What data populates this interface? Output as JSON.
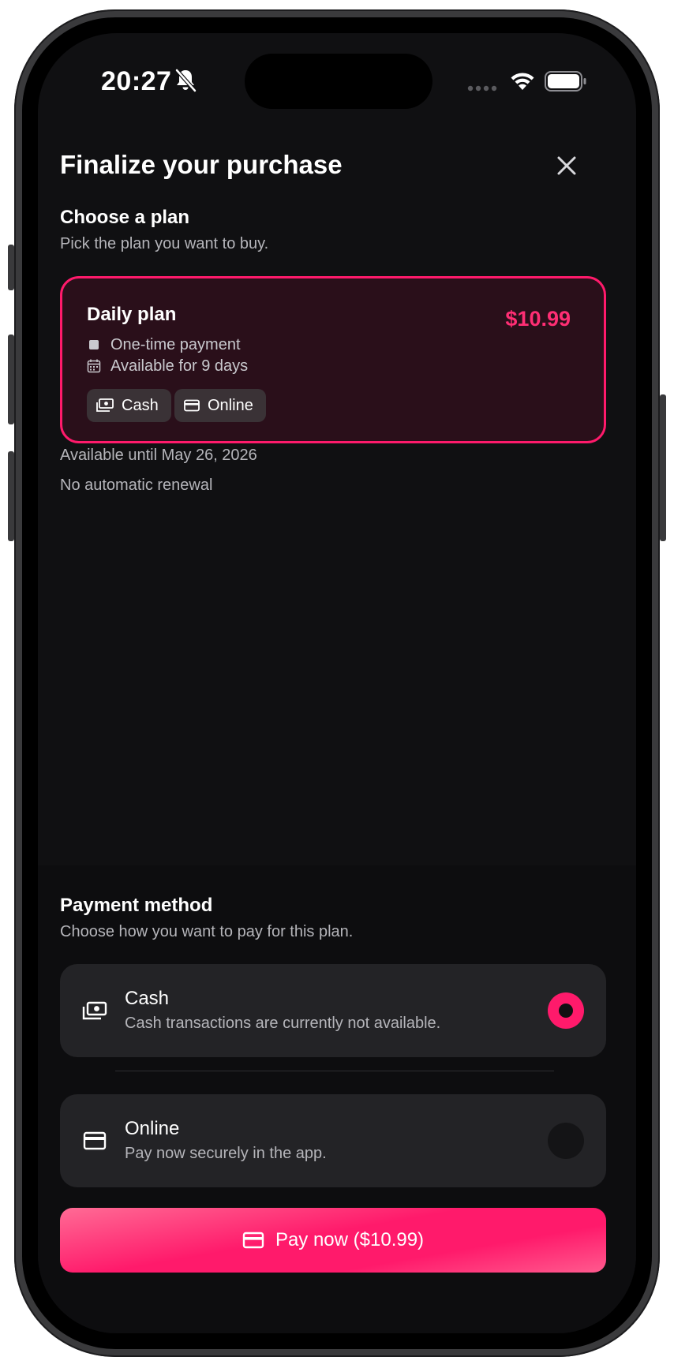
{
  "status_bar": {
    "time": "20:27"
  },
  "header": {
    "title": "Finalize your purchase"
  },
  "plan_section": {
    "title": "Choose a plan",
    "subtitle": "Pick the plan you want to buy."
  },
  "plan": {
    "name": "Daily plan",
    "price": "$10.99",
    "features": [
      "One-time payment",
      "Available for 9 days"
    ],
    "payment_chips": [
      "Cash",
      "Online"
    ],
    "available_until": "Available until May 26, 2026",
    "renewal": "No automatic renewal"
  },
  "payment_section": {
    "title": "Payment method",
    "subtitle": "Choose how you want to pay for this plan.",
    "options": [
      {
        "label": "Cash",
        "description": "Cash transactions are currently not available.",
        "selected": true
      },
      {
        "label": "Online",
        "description": "Pay now securely in the app.",
        "selected": false
      }
    ]
  },
  "pay_button": {
    "label": "Pay now ($10.99)"
  },
  "colors": {
    "accent": "#ff1a6b",
    "background": "#101012",
    "card": "#232326"
  }
}
